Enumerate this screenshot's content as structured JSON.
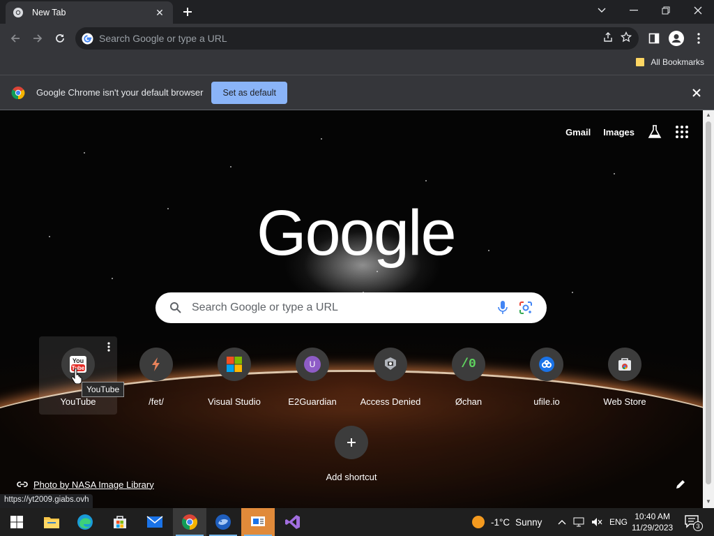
{
  "browser": {
    "tab_title": "New Tab",
    "omnibox_placeholder": "Search Google or type a URL",
    "all_bookmarks": "All Bookmarks",
    "infobar_message": "Google Chrome isn't your default browser",
    "set_default_label": "Set as default"
  },
  "ntp": {
    "top_links": {
      "gmail": "Gmail",
      "images": "Images"
    },
    "logo_text": "Google",
    "search_placeholder": "Search Google or type a URL",
    "shortcuts": [
      {
        "label": "YouTube",
        "icon": "youtube-icon"
      },
      {
        "label": "/fet/",
        "icon": "lightning-icon"
      },
      {
        "label": "Visual Studio",
        "icon": "microsoft-icon"
      },
      {
        "label": "E2Guardian",
        "icon": "letter-u-icon",
        "letter": "U"
      },
      {
        "label": "Access Denied",
        "icon": "security-badge-icon"
      },
      {
        "label": "Øchan",
        "icon": "slash-zero-icon",
        "glyph": "/0"
      },
      {
        "label": "ufile.io",
        "icon": "cloud-icon"
      },
      {
        "label": "Web Store",
        "icon": "web-store-icon"
      }
    ],
    "tooltip": "YouTube",
    "add_shortcut": "Add shortcut",
    "photo_credit": "Photo by NASA Image Library",
    "status_url": "https://yt2009.giabs.ovh"
  },
  "taskbar": {
    "weather_temp": "-1°C",
    "weather_desc": "Sunny",
    "language": "ENG",
    "time": "10:40 AM",
    "date": "11/29/2023",
    "notification_count": "3"
  },
  "colors": {
    "chrome_dark": "#202124",
    "toolbar": "#35363a",
    "accent_button": "#8ab4f8",
    "taskbar": "#1f1f1f"
  }
}
